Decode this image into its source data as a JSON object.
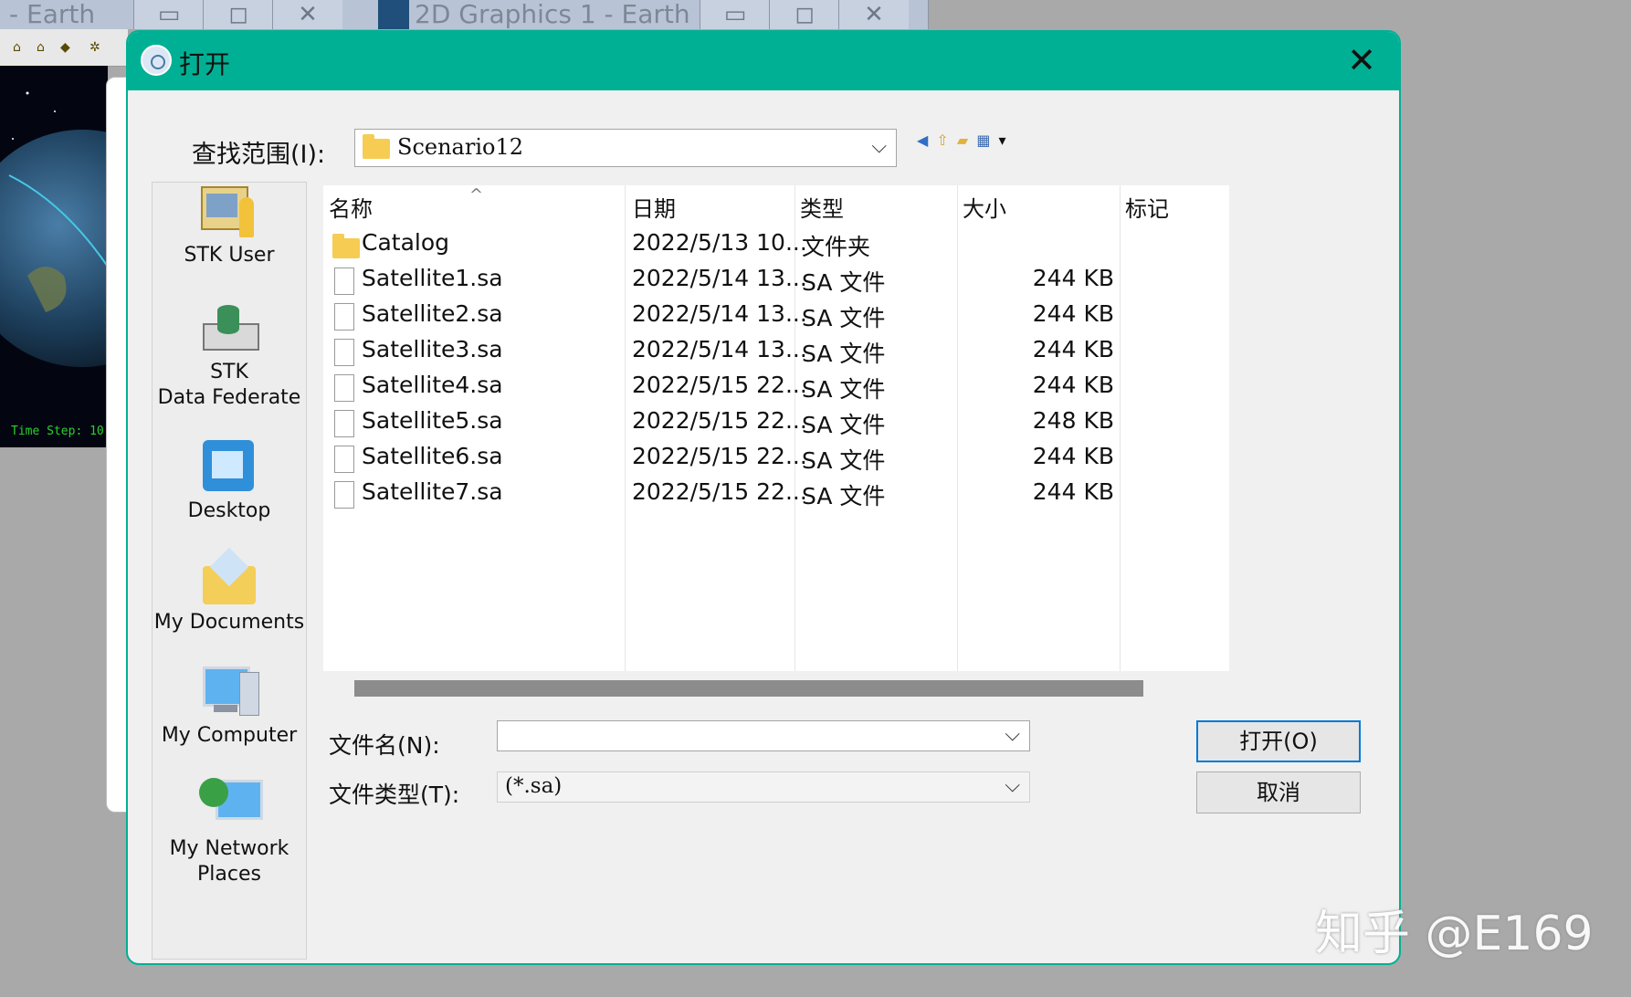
{
  "background": {
    "win1_title": "- Earth",
    "win2_title": "2D Graphics 1 - Earth",
    "minimize": "▭",
    "restore": "◻",
    "close": "✕",
    "status_text": "Time Step: 10"
  },
  "dialog": {
    "title": "打开",
    "look_in_label": "查找范围(I):",
    "look_in_value": "Scenario12",
    "places": [
      {
        "label": "STK User"
      },
      {
        "label_line1": "STK",
        "label_line2": "Data Federate"
      },
      {
        "label": "Desktop"
      },
      {
        "label": "My Documents"
      },
      {
        "label": "My Computer"
      },
      {
        "label_line1": "My Network",
        "label_line2": "Places"
      }
    ],
    "columns": [
      "名称",
      "日期",
      "类型",
      "大小",
      "标记"
    ],
    "files": [
      {
        "name": "Catalog",
        "date": "2022/5/13 10...",
        "type": "文件夹",
        "size": "",
        "kind": "folder"
      },
      {
        "name": "Satellite1.sa",
        "date": "2022/5/14 13...",
        "type": "SA 文件",
        "size": "244 KB",
        "kind": "file"
      },
      {
        "name": "Satellite2.sa",
        "date": "2022/5/14 13...",
        "type": "SA 文件",
        "size": "244 KB",
        "kind": "file"
      },
      {
        "name": "Satellite3.sa",
        "date": "2022/5/14 13...",
        "type": "SA 文件",
        "size": "244 KB",
        "kind": "file"
      },
      {
        "name": "Satellite4.sa",
        "date": "2022/5/15 22...",
        "type": "SA 文件",
        "size": "244 KB",
        "kind": "file"
      },
      {
        "name": "Satellite5.sa",
        "date": "2022/5/15 22...",
        "type": "SA 文件",
        "size": "248 KB",
        "kind": "file"
      },
      {
        "name": "Satellite6.sa",
        "date": "2022/5/15 22...",
        "type": "SA 文件",
        "size": "244 KB",
        "kind": "file"
      },
      {
        "name": "Satellite7.sa",
        "date": "2022/5/15 22...",
        "type": "SA 文件",
        "size": "244 KB",
        "kind": "file"
      }
    ],
    "filename_label": "文件名(N):",
    "filename_value": "",
    "filetype_label": "文件类型(T):",
    "filetype_value": "(*.sa)",
    "open_button": "打开(O)",
    "cancel_button": "取消"
  },
  "watermark": "知乎 @E169",
  "colors": {
    "accent": "#00b094",
    "focus": "#0078d7"
  }
}
